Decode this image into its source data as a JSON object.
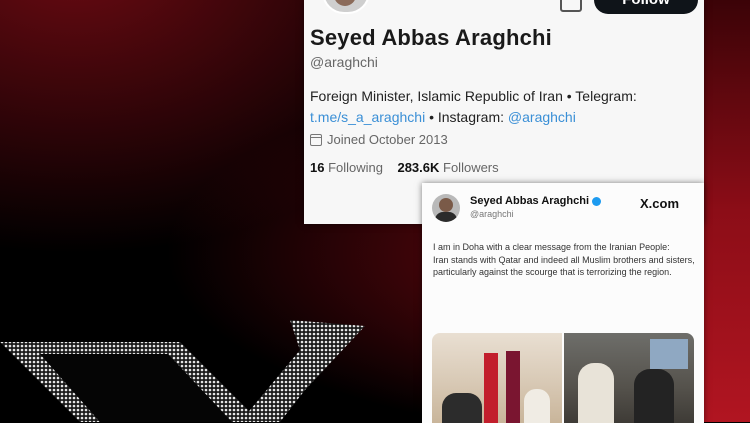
{
  "profile": {
    "follow_label": "Follow",
    "name": "Seyed Abbas Araghchi",
    "handle": "@araghchi",
    "bio_text": "Foreign Minister, Islamic Republic of Iran • Telegram: ",
    "bio_telegram_link": "t.me/s_a_araghchi",
    "bio_instagram_prefix": " • Instagram: ",
    "bio_instagram_link": "@araghchi",
    "joined": "Joined October 2013",
    "following_count": "16",
    "following_label": "Following",
    "followers_count": "283.6K",
    "followers_label": "Followers"
  },
  "tweet": {
    "author_name": "Seyed Abbas Araghchi",
    "author_handle": "@araghchi",
    "source": "X.com",
    "text_line1": "I am in Doha with a clear message from the Iranian People:",
    "text_line2": "Iran stands with Qatar and indeed all Muslim brothers and sisters, particularly against the scourge that is terrorizing the region."
  },
  "icons": {
    "calendar": "calendar-icon",
    "verified": "verified-badge-icon",
    "more": "more-options-icon",
    "logo": "x-logo-icon"
  },
  "colors": {
    "accent_red": "#a0101c",
    "link_blue": "#3a8fd6",
    "verified_blue": "#1d9bf0"
  }
}
